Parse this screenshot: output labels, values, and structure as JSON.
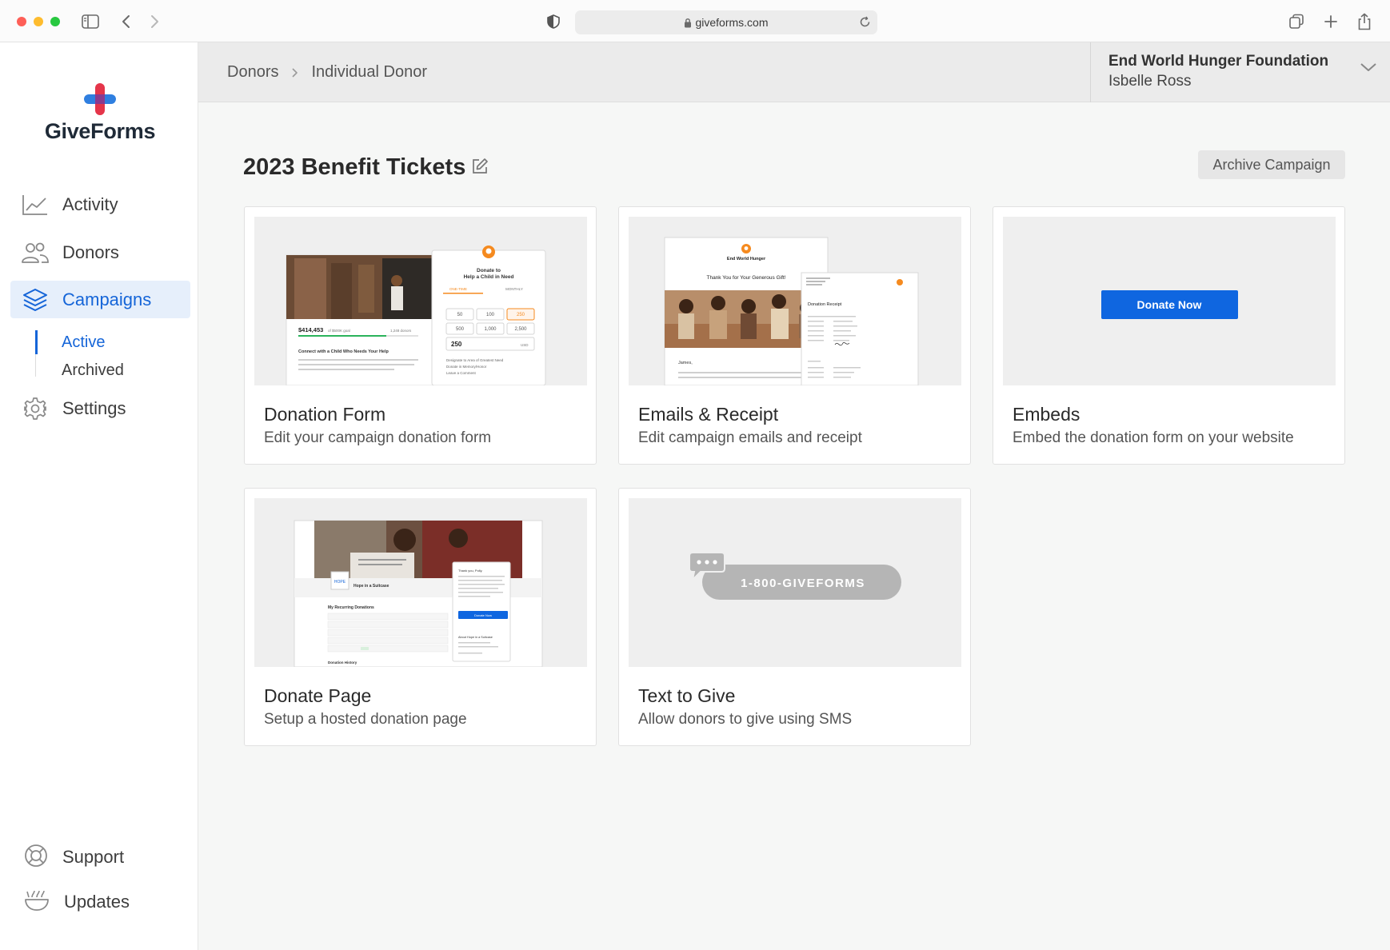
{
  "browser": {
    "url": "giveforms.com"
  },
  "brand": {
    "name": "GiveForms",
    "accent_blue": "#1565d8",
    "logo_red": "#e5354a",
    "logo_blue": "#2f7fe0"
  },
  "sidebar": {
    "items": [
      {
        "label": "Activity",
        "icon": "activity-chart-icon"
      },
      {
        "label": "Donors",
        "icon": "donors-people-icon"
      },
      {
        "label": "Campaigns",
        "icon": "campaigns-layers-icon",
        "active": true
      },
      {
        "label": "Settings",
        "icon": "settings-gear-icon"
      }
    ],
    "campaign_subitems": [
      {
        "label": "Active",
        "active": true
      },
      {
        "label": "Archived"
      }
    ],
    "footer": [
      {
        "label": "Support",
        "icon": "support-lifebuoy-icon"
      },
      {
        "label": "Updates",
        "icon": "updates-bowl-icon"
      }
    ]
  },
  "topbar": {
    "breadcrumb": [
      "Donors",
      "Individual Donor"
    ],
    "organization": "End World Hunger Foundation",
    "user": "Isbelle Ross"
  },
  "page": {
    "title": "2023 Benefit Tickets",
    "archive_label": "Archive Campaign"
  },
  "cards": [
    {
      "title": "Donation Form",
      "description": "Edit your campaign donation form",
      "preview": {
        "raised": "$414,453",
        "goal": "of $500K goal",
        "donors": "1,248 donors",
        "headline": "Connect with a Child Who Needs Your Help",
        "body": "Help those living in poverty feel human again by giving them the gift of dignity through supporting aid, shelter, education and mentorship.",
        "form_title": "Donate to Help a Child in Need",
        "tabs": [
          "ONE-TIME",
          "MONTHLY"
        ],
        "amounts": [
          "50",
          "100",
          "250",
          "500",
          "1,000",
          "2,500"
        ],
        "amount_value": "250",
        "currency": "USD",
        "designate": "Designate to Area of Greatest Need",
        "memory": "Donate in Memory/Honor",
        "comment": "Leave a Comment"
      }
    },
    {
      "title": "Emails & Receipt",
      "description": "Edit campaign emails and receipt",
      "preview": {
        "org": "End World Hunger",
        "email_heading": "Thank You for Your Generous Gift!",
        "greeting": "James,",
        "email_body": "Thank you for your generous gift of $150.00 to Doctors Without Borders. Your gift sends essential support to MSF health care",
        "receipt_title": "Donation Receipt"
      }
    },
    {
      "title": "Embeds",
      "description": "Embed the donation form on your website",
      "preview": {
        "button_label": "Donate Now"
      }
    },
    {
      "title": "Donate Page",
      "description": "Setup a hosted donation page",
      "preview": {
        "org": "Hope in a Suitcase",
        "section": "My Recurring Donations",
        "thank_you": "Thank you, Polly.",
        "button_label": "Donate Now",
        "about": "About Hope in a Suitcase",
        "history": "Donation History"
      }
    },
    {
      "title": "Text to Give",
      "description": "Allow donors to give using SMS",
      "preview": {
        "phone": "1-800-GIVEFORMS"
      }
    }
  ]
}
